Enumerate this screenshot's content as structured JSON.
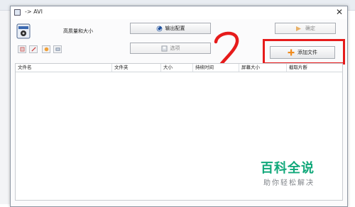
{
  "window": {
    "title": "-> AVI"
  },
  "settings": {
    "quality_label": "高质量和大小"
  },
  "buttons": {
    "output_config": "输出配置",
    "options": "选项",
    "ok": "确定",
    "add_file": "添加文件"
  },
  "annotation": {
    "step_number": "2",
    "highlight_color": "#e61b1b"
  },
  "table": {
    "columns": [
      "文件名",
      "文件夹",
      "大小",
      "持续时间",
      "屏幕大小",
      "截取片断"
    ],
    "rows": []
  },
  "watermark": {
    "main": "百科全说",
    "sub": "助你轻松解决",
    "color": "#11a87a"
  },
  "icons": [
    "video-format-icon",
    "output-config-icon",
    "options-icon",
    "ok-icon",
    "add-plus-icon",
    "close-icon"
  ]
}
